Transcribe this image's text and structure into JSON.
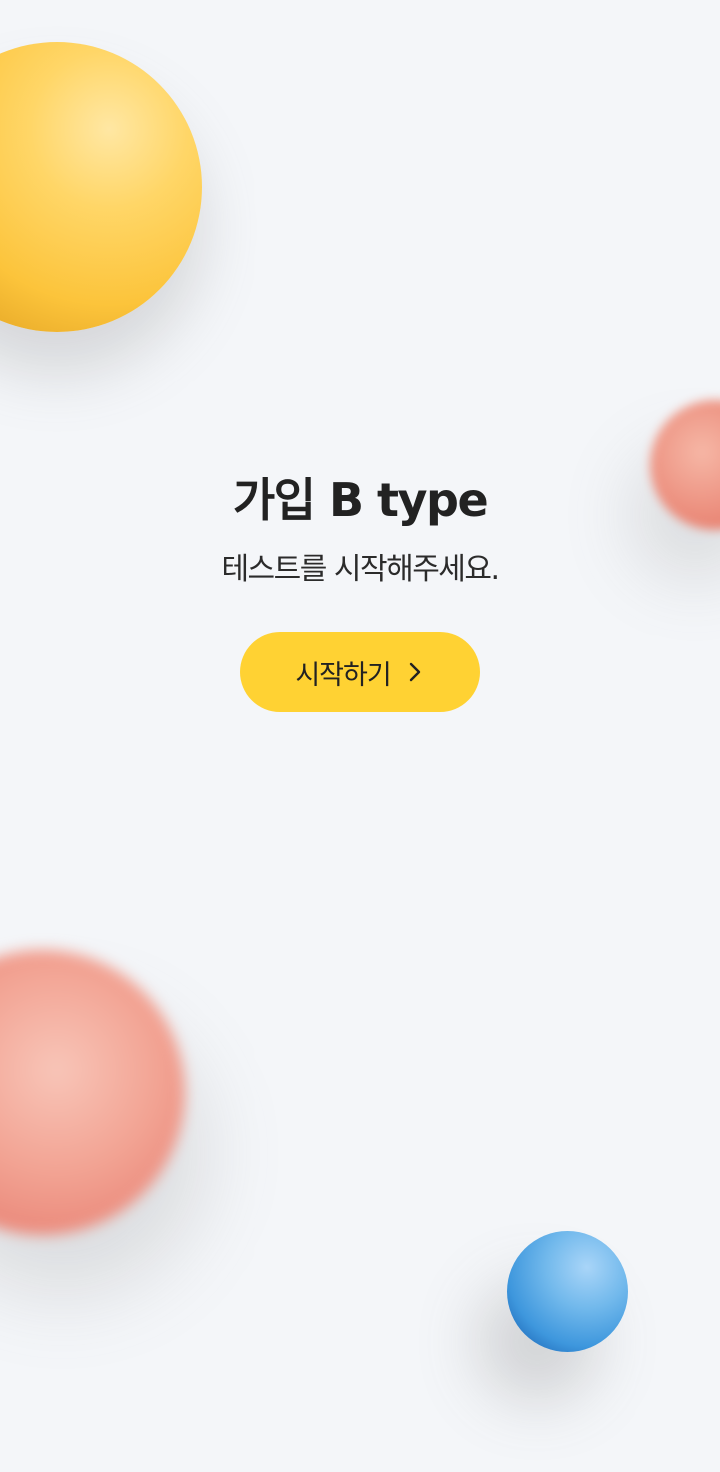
{
  "screen": {
    "title": "가입 B type",
    "subtitle": "테스트를 시작해주세요.",
    "start_button": {
      "label": "시작하기",
      "icon": "chevron-right-icon"
    }
  },
  "colors": {
    "background": "#f4f6f9",
    "button": "#ffd233",
    "text": "#222222"
  }
}
